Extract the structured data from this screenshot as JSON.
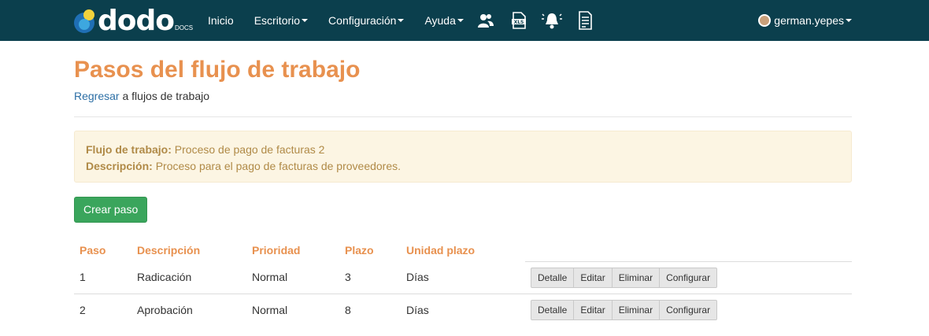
{
  "brand": {
    "name": "dodo",
    "sub": "DOCS"
  },
  "nav": {
    "items": [
      {
        "label": "Inicio",
        "dropdown": false
      },
      {
        "label": "Escritorio",
        "dropdown": true
      },
      {
        "label": "Configuración",
        "dropdown": true
      },
      {
        "label": "Ayuda",
        "dropdown": true
      }
    ],
    "icons": [
      "users-icon",
      "xls-file-icon",
      "bell-icon",
      "document-list-icon"
    ],
    "user": "german.yepes"
  },
  "page": {
    "title": "Pasos del flujo de trabajo",
    "back_link": "Regresar",
    "back_suffix": " a flujos de trabajo"
  },
  "info": {
    "workflow_label": "Flujo de trabajo:",
    "workflow_value": " Proceso de pago de facturas 2",
    "description_label": "Descripción:",
    "description_value": " Proceso para el pago de facturas de proveedores."
  },
  "create_button": "Crear paso",
  "table": {
    "headers": [
      "Paso",
      "Descripción",
      "Prioridad",
      "Plazo",
      "Unidad plazo"
    ],
    "rows": [
      {
        "paso": "1",
        "descripcion": "Radicación",
        "prioridad": "Normal",
        "plazo": "3",
        "unidad": "Días"
      },
      {
        "paso": "2",
        "descripcion": "Aprobación",
        "prioridad": "Normal",
        "plazo": "8",
        "unidad": "Días"
      }
    ],
    "actions": [
      "Detalle",
      "Editar",
      "Eliminar",
      "Configurar"
    ]
  },
  "colors": {
    "navbar": "#0b3f4d",
    "accent": "#e8914f",
    "link": "#2c6fa5",
    "success": "#3aa55c",
    "warning_bg": "#fcf5e3",
    "warning_text": "#b08a47"
  }
}
